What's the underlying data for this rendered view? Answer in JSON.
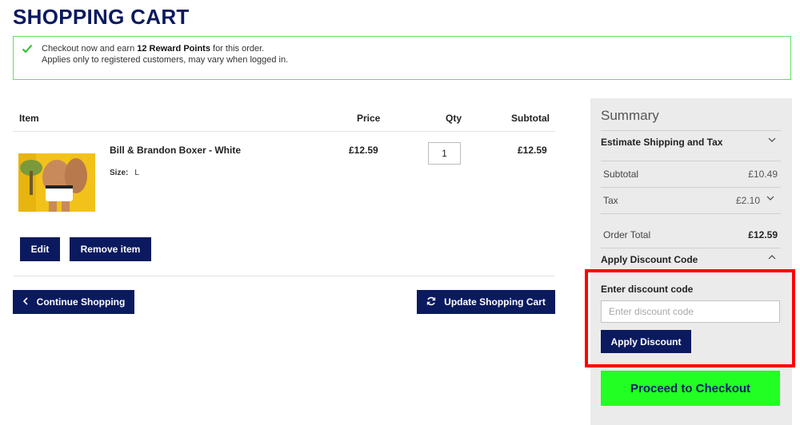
{
  "page": {
    "title": "SHOPPING CART"
  },
  "reward_notice": {
    "line1_prefix": "Checkout now and earn ",
    "points_text": "12 Reward Points",
    "line1_suffix": " for this order.",
    "line2": "Applies only to registered customers, may vary when logged in.",
    "icon": "checkmark-icon",
    "border_color": "#5fe15f"
  },
  "cart": {
    "headers": {
      "item": "Item",
      "price": "Price",
      "qty": "Qty",
      "subtotal": "Subtotal"
    },
    "items": [
      {
        "name": "Bill & Brandon Boxer - White",
        "size_label": "Size:",
        "size_value": "L",
        "price": "£12.59",
        "qty": "1",
        "subtotal": "£12.59",
        "edit_label": "Edit",
        "remove_label": "Remove item"
      }
    ],
    "continue_label": "Continue Shopping",
    "update_label": "Update Shopping Cart"
  },
  "summary": {
    "title": "Summary",
    "estimate_label": "Estimate Shipping and Tax",
    "subtotal_label": "Subtotal",
    "subtotal_value": "£10.49",
    "tax_label": "Tax",
    "tax_value": "£2.10",
    "order_total_label": "Order Total",
    "order_total_value": "£12.59",
    "discount_toggle_label": "Apply Discount Code",
    "discount_field_label": "Enter discount code",
    "discount_placeholder": "Enter discount code",
    "apply_label": "Apply Discount",
    "checkout_label": "Proceed to Checkout"
  },
  "colors": {
    "brand_navy": "#0b1a5e",
    "checkout_green": "#22ff22",
    "highlight_red": "#ff0000",
    "summary_bg": "#ebebeb"
  }
}
